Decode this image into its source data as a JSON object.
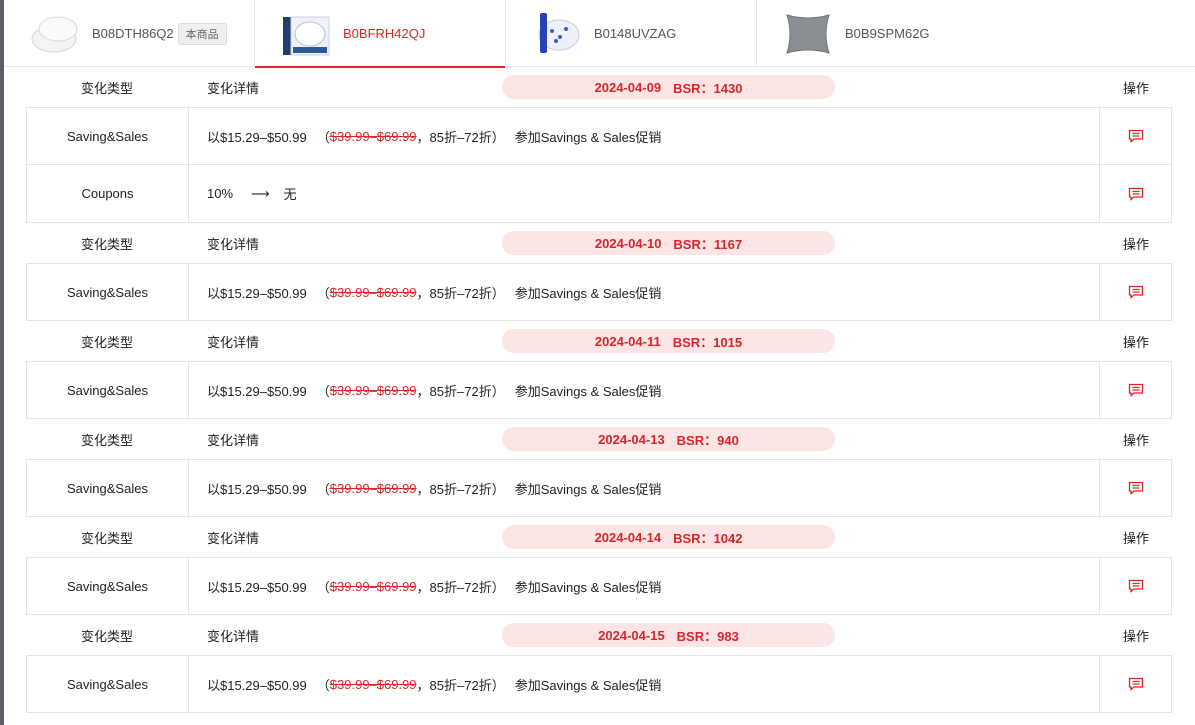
{
  "tabs": [
    {
      "code": "B08DTH86Q2",
      "badge": "本商品",
      "active": false,
      "thumb_icon": "white-pillows-product-icon"
    },
    {
      "code": "B0BFRH42QJ",
      "active": true,
      "thumb_icon": "pillow-box-product-icon"
    },
    {
      "code": "B0148UVZAG",
      "active": false,
      "thumb_icon": "blue-pillow-product-icon"
    },
    {
      "code": "B0B9SPM62G",
      "active": false,
      "thumb_icon": "gray-pillow-product-icon"
    }
  ],
  "header_labels": {
    "type": "变化类型",
    "detail": "变化详情",
    "op": "操作"
  },
  "groups": [
    {
      "date": "2024-04-09",
      "bsr": "BSR：1430",
      "rows": [
        {
          "type": "Saving&Sales",
          "price": "以$15.29–$50.99",
          "paren_open": "（",
          "orig": "$39.99–$69.99",
          "discount": "，85折–72折）",
          "promo": "参加Savings & Sales促销"
        },
        {
          "type": "Coupons",
          "from": "10%",
          "arrow": "⟶",
          "to": "无"
        }
      ]
    },
    {
      "date": "2024-04-10",
      "bsr": "BSR：1167",
      "rows": [
        {
          "type": "Saving&Sales",
          "price": "以$15.29–$50.99",
          "paren_open": "（",
          "orig": "$39.99–$69.99",
          "discount": "，85折–72折）",
          "promo": "参加Savings & Sales促销"
        }
      ]
    },
    {
      "date": "2024-04-11",
      "bsr": "BSR：1015",
      "rows": [
        {
          "type": "Saving&Sales",
          "price": "以$15.29–$50.99",
          "paren_open": "（",
          "orig": "$39.99–$69.99",
          "discount": "，85折–72折）",
          "promo": "参加Savings & Sales促销"
        }
      ]
    },
    {
      "date": "2024-04-13",
      "bsr": "BSR：940",
      "rows": [
        {
          "type": "Saving&Sales",
          "price": "以$15.29–$50.99",
          "paren_open": "（",
          "orig": "$39.99–$69.99",
          "discount": "，85折–72折）",
          "promo": "参加Savings & Sales促销"
        }
      ]
    },
    {
      "date": "2024-04-14",
      "bsr": "BSR：1042",
      "rows": [
        {
          "type": "Saving&Sales",
          "price": "以$15.29–$50.99",
          "paren_open": "（",
          "orig": "$39.99–$69.99",
          "discount": "，85折–72折）",
          "promo": "参加Savings & Sales促销"
        }
      ]
    },
    {
      "date": "2024-04-15",
      "bsr": "BSR：983",
      "rows": [
        {
          "type": "Saving&Sales",
          "price": "以$15.29–$50.99",
          "paren_open": "（",
          "orig": "$39.99–$69.99",
          "discount": "，85折–72折）",
          "promo": "参加Savings & Sales促销"
        }
      ]
    }
  ],
  "colors": {
    "accent": "#e02424",
    "date_pill_bg": "#fde5e6",
    "border": "#e4e4e4"
  },
  "row_action_icon": "comment-icon"
}
